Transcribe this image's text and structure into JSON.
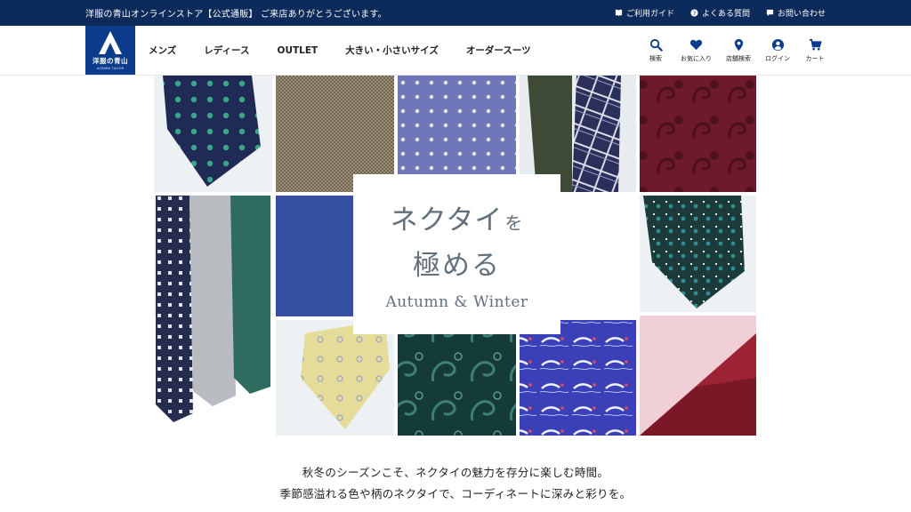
{
  "topbar": {
    "notice": "洋服の青山オンラインストア【公式通販】 ご来店ありがとうございます。",
    "links": [
      {
        "label": "ご利用ガイド",
        "icon": "guide-icon"
      },
      {
        "label": "よくある質問",
        "icon": "question-icon"
      },
      {
        "label": "お問い合わせ",
        "icon": "mail-icon"
      }
    ],
    "bg_color": "#0c2a5a"
  },
  "logo": {
    "text": "洋服の青山",
    "sub": "AOYAMA TAILOR",
    "bg_color": "#0c3b8c"
  },
  "nav": {
    "items": [
      "メンズ",
      "レディース",
      "OUTLET",
      "大きい・小さいサイズ",
      "オーダースーツ"
    ]
  },
  "utils": {
    "items": [
      {
        "label": "検索",
        "icon": "search-icon"
      },
      {
        "label": "お気に入り",
        "icon": "heart-icon"
      },
      {
        "label": "店舗検索",
        "icon": "location-pin-icon"
      },
      {
        "label": "ログイン",
        "icon": "user-icon"
      },
      {
        "label": "カート",
        "icon": "cart-icon"
      }
    ]
  },
  "hero": {
    "title_main": "ネクタイ",
    "title_particle": "を",
    "title_line2": "極める",
    "subtitle": "Autumn & Winter"
  },
  "intro": {
    "line1": "秋冬のシーズンこそ、ネクタイの魅力を存分に楽しむ時間。",
    "line2": "季節感溢れる色や柄のネクタイで、コーディネートに深みと彩りを。"
  }
}
